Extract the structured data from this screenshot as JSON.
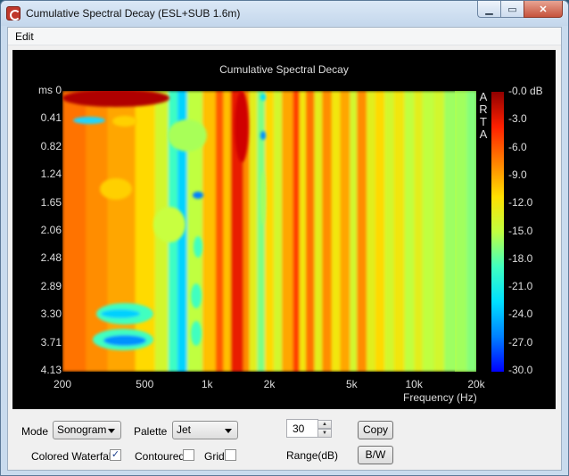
{
  "window": {
    "title": "Cumulative Spectral Decay  (ESL+SUB 1.6m)"
  },
  "menu": {
    "items": [
      "Edit"
    ]
  },
  "chart_data": {
    "type": "heatmap",
    "title": "Cumulative Spectral Decay",
    "xlabel": "Frequency (Hz)",
    "ylabel": "ms",
    "watermark": "ARTA",
    "x_scale": "log",
    "x_range_hz": [
      200,
      20000
    ],
    "x_ticks": [
      "200",
      "500",
      "1k",
      "2k",
      "5k",
      "10k",
      "20k"
    ],
    "x_tick_values": [
      200,
      500,
      1000,
      2000,
      5000,
      10000,
      20000
    ],
    "y_ticks": [
      "0",
      "0.41",
      "0.82",
      "1.24",
      "1.65",
      "2.06",
      "2.48",
      "2.89",
      "3.30",
      "3.71",
      "4.13"
    ],
    "y_range_ms": [
      0,
      4.13
    ],
    "colorbar": {
      "palette": "Jet",
      "labels": [
        "-0.0 dB",
        "-3.0",
        "-6.0",
        "-9.0",
        "-12.0",
        "-15.0",
        "-18.0",
        "-21.0",
        "-24.0",
        "-27.0",
        "-30.0"
      ],
      "range_db": [
        -30,
        0
      ]
    },
    "bands": [
      {
        "f_start": 200,
        "f_end": 260,
        "level_db": -7
      },
      {
        "f_start": 260,
        "f_end": 330,
        "level_db": -8
      },
      {
        "f_start": 330,
        "f_end": 450,
        "level_db": -9
      },
      {
        "f_start": 450,
        "f_end": 560,
        "level_db": -11
      },
      {
        "f_start": 560,
        "f_end": 650,
        "level_db": -14
      },
      {
        "f_start": 650,
        "f_end": 720,
        "level_db": -19
      },
      {
        "f_start": 720,
        "f_end": 800,
        "level_db": -23
      },
      {
        "f_start": 800,
        "f_end": 950,
        "level_db": -15
      },
      {
        "f_start": 950,
        "f_end": 1100,
        "level_db": -10
      },
      {
        "f_start": 1100,
        "f_end": 1200,
        "level_db": -6
      },
      {
        "f_start": 1200,
        "f_end": 1300,
        "level_db": -10
      },
      {
        "f_start": 1300,
        "f_end": 1500,
        "level_db": -3
      },
      {
        "f_start": 1500,
        "f_end": 1600,
        "level_db": -8
      },
      {
        "f_start": 1600,
        "f_end": 1750,
        "level_db": -13
      },
      {
        "f_start": 1750,
        "f_end": 1900,
        "level_db": -17
      },
      {
        "f_start": 1900,
        "f_end": 2100,
        "level_db": -11
      },
      {
        "f_start": 2100,
        "f_end": 2300,
        "level_db": -14
      },
      {
        "f_start": 2300,
        "f_end": 2600,
        "level_db": -9
      },
      {
        "f_start": 2600,
        "f_end": 2800,
        "level_db": -5
      },
      {
        "f_start": 2800,
        "f_end": 3000,
        "level_db": -12
      },
      {
        "f_start": 3000,
        "f_end": 3300,
        "level_db": -7
      },
      {
        "f_start": 3300,
        "f_end": 3600,
        "level_db": -13
      },
      {
        "f_start": 3600,
        "f_end": 4000,
        "level_db": -8
      },
      {
        "f_start": 4000,
        "f_end": 4400,
        "level_db": -12
      },
      {
        "f_start": 4400,
        "f_end": 4900,
        "level_db": -9
      },
      {
        "f_start": 4900,
        "f_end": 5300,
        "level_db": -14
      },
      {
        "f_start": 5300,
        "f_end": 5900,
        "level_db": -8
      },
      {
        "f_start": 5900,
        "f_end": 6500,
        "level_db": -13
      },
      {
        "f_start": 6500,
        "f_end": 7200,
        "level_db": -11
      },
      {
        "f_start": 7200,
        "f_end": 8000,
        "level_db": -14
      },
      {
        "f_start": 8000,
        "f_end": 9000,
        "level_db": -12
      },
      {
        "f_start": 9000,
        "f_end": 10000,
        "level_db": -15
      },
      {
        "f_start": 10000,
        "f_end": 11000,
        "level_db": -13
      },
      {
        "f_start": 11000,
        "f_end": 12500,
        "level_db": -15
      },
      {
        "f_start": 12500,
        "f_end": 14000,
        "level_db": -14
      },
      {
        "f_start": 14000,
        "f_end": 16000,
        "level_db": -16
      },
      {
        "f_start": 16000,
        "f_end": 18000,
        "level_db": -17
      },
      {
        "f_start": 18000,
        "f_end": 20000,
        "level_db": -19
      }
    ]
  },
  "controls": {
    "mode_label": "Mode",
    "mode_value": "Sonogram",
    "palette_label": "Palette",
    "palette_value": "Jet",
    "range_value": "30",
    "range_label": "Range(dB)",
    "copy_label": "Copy",
    "bw_label": "B/W",
    "colored_waterfall_label": "Colored Waterfall",
    "colored_waterfall_checked": true,
    "contoured_label": "Contoured",
    "contoured_checked": false,
    "grid_label": "Grid",
    "grid_checked": false
  }
}
